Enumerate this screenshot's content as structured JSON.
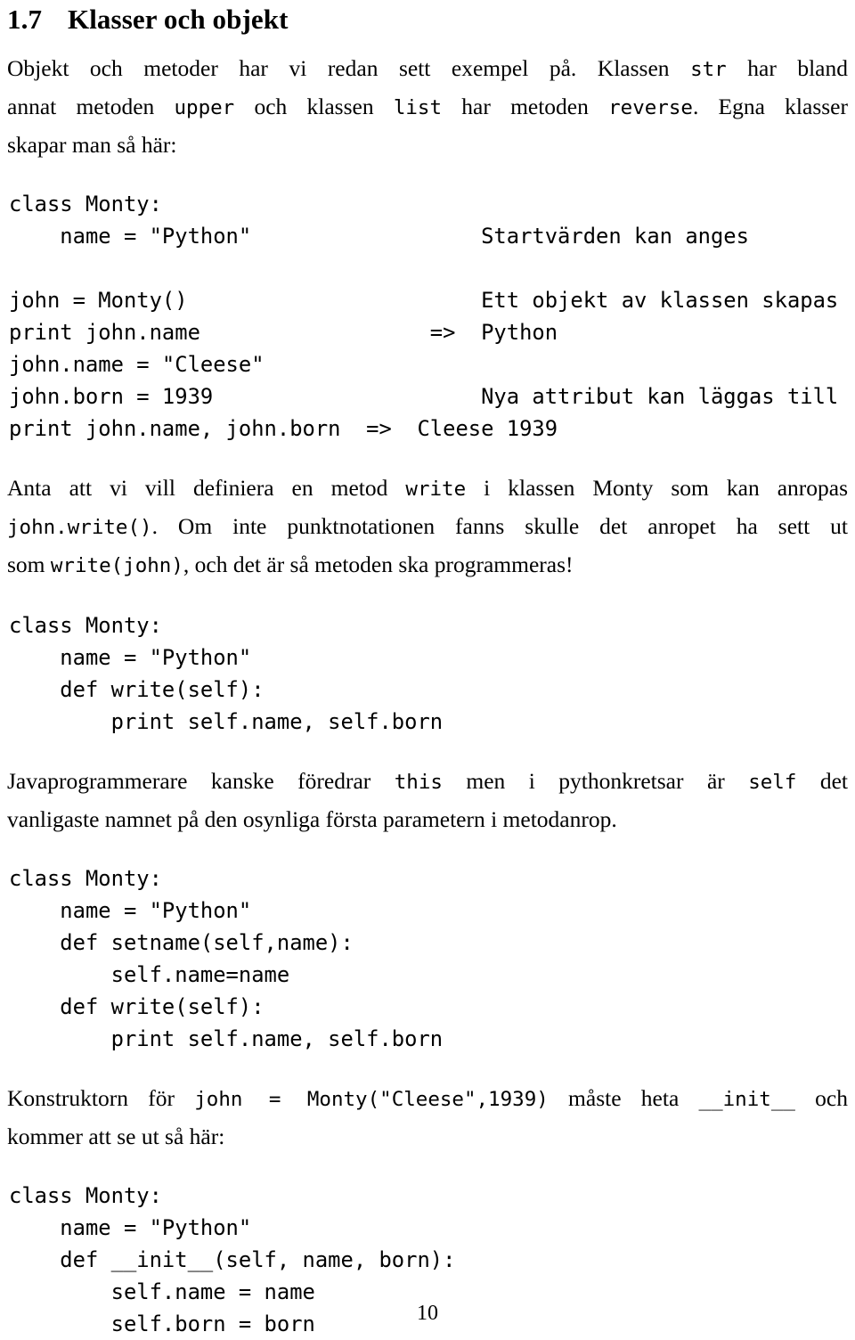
{
  "document": {
    "language": "sv",
    "page_number": "10",
    "heading": {
      "number": "1.7",
      "title": "Klasser och objekt"
    }
  },
  "paragraphs": {
    "intro": {
      "line1": "Objekt och metoder har vi redan sett exempel på. Klassen str har bland",
      "line2": "annat metoden upper och klassen list har metoden reverse. Egna klasser",
      "line3": "skapar man så här:",
      "l1_a": "Objekt och metoder har vi redan sett exempel på. Klassen ",
      "l1_code": "str",
      "l1_b": " har bland",
      "l2_a": "annat metoden ",
      "l2_code1": "upper",
      "l2_b": " och klassen ",
      "l2_code2": "list",
      "l2_c": " har metoden ",
      "l2_code3": "reverse",
      "l2_d": ". Egna klasser",
      "l3_a": "skapar man så här:"
    },
    "write_method": {
      "l1_a": "Anta att vi vill definiera en metod ",
      "l1_code": "write",
      "l1_b": " i klassen Monty som kan anropas",
      "l2_code": "john.write()",
      "l2_a": ". Om inte punktnotationen fanns skulle det anropet ha sett ut",
      "l3_a": "som ",
      "l3_code": "write(john)",
      "l3_b": ", och det är så metoden ska programmeras!"
    },
    "self_note": {
      "l1_a": "Javaprogrammerare kanske föredrar ",
      "l1_code1": "this",
      "l1_b": " men i pythonkretsar är ",
      "l1_code2": "self",
      "l1_c": " det",
      "l2_a": "vanligaste namnet på den osynliga första parametern i metodanrop."
    },
    "constructor": {
      "l1_a": "Konstruktorn för ",
      "l1_code1": "john = Monty(\"Cleese\",1939)",
      "l1_b": " måste heta ",
      "l1_code2": "__init__",
      "l1_c": " och",
      "l2_a": "kommer att se ut så här:"
    }
  },
  "code_blocks": {
    "block1": "class Monty:\n    name = \"Python\"                  Startvärden kan anges\n\njohn = Monty()                       Ett objekt av klassen skapas\nprint john.name                  =>  Python\njohn.name = \"Cleese\"\njohn.born = 1939                     Nya attribut kan läggas till\nprint john.name, john.born  =>  Cleese 1939",
    "block1_lines": [
      "class Monty:",
      "    name = \"Python\"                  Startvärden kan anges",
      "",
      "john = Monty()                       Ett objekt av klassen skapas",
      "print john.name                  =>  Python",
      "john.name = \"Cleese\"",
      "john.born = 1939                     Nya attribut kan läggas till",
      "print john.name, john.born   =>  Cleese 1939"
    ],
    "block2": "class Monty:\n    name = \"Python\"\n    def write(self):\n        print self.name, self.born",
    "block3": "class Monty:\n    name = \"Python\"\n    def setname(self,name):\n        self.name=name\n    def write(self):\n        print self.name, self.born",
    "block4": "class Monty:\n    name = \"Python\"\n    def __init__(self, name, born):\n        self.name = name\n        self.born = born"
  },
  "colors": {
    "background": "#ffffff",
    "text": "#000000"
  }
}
